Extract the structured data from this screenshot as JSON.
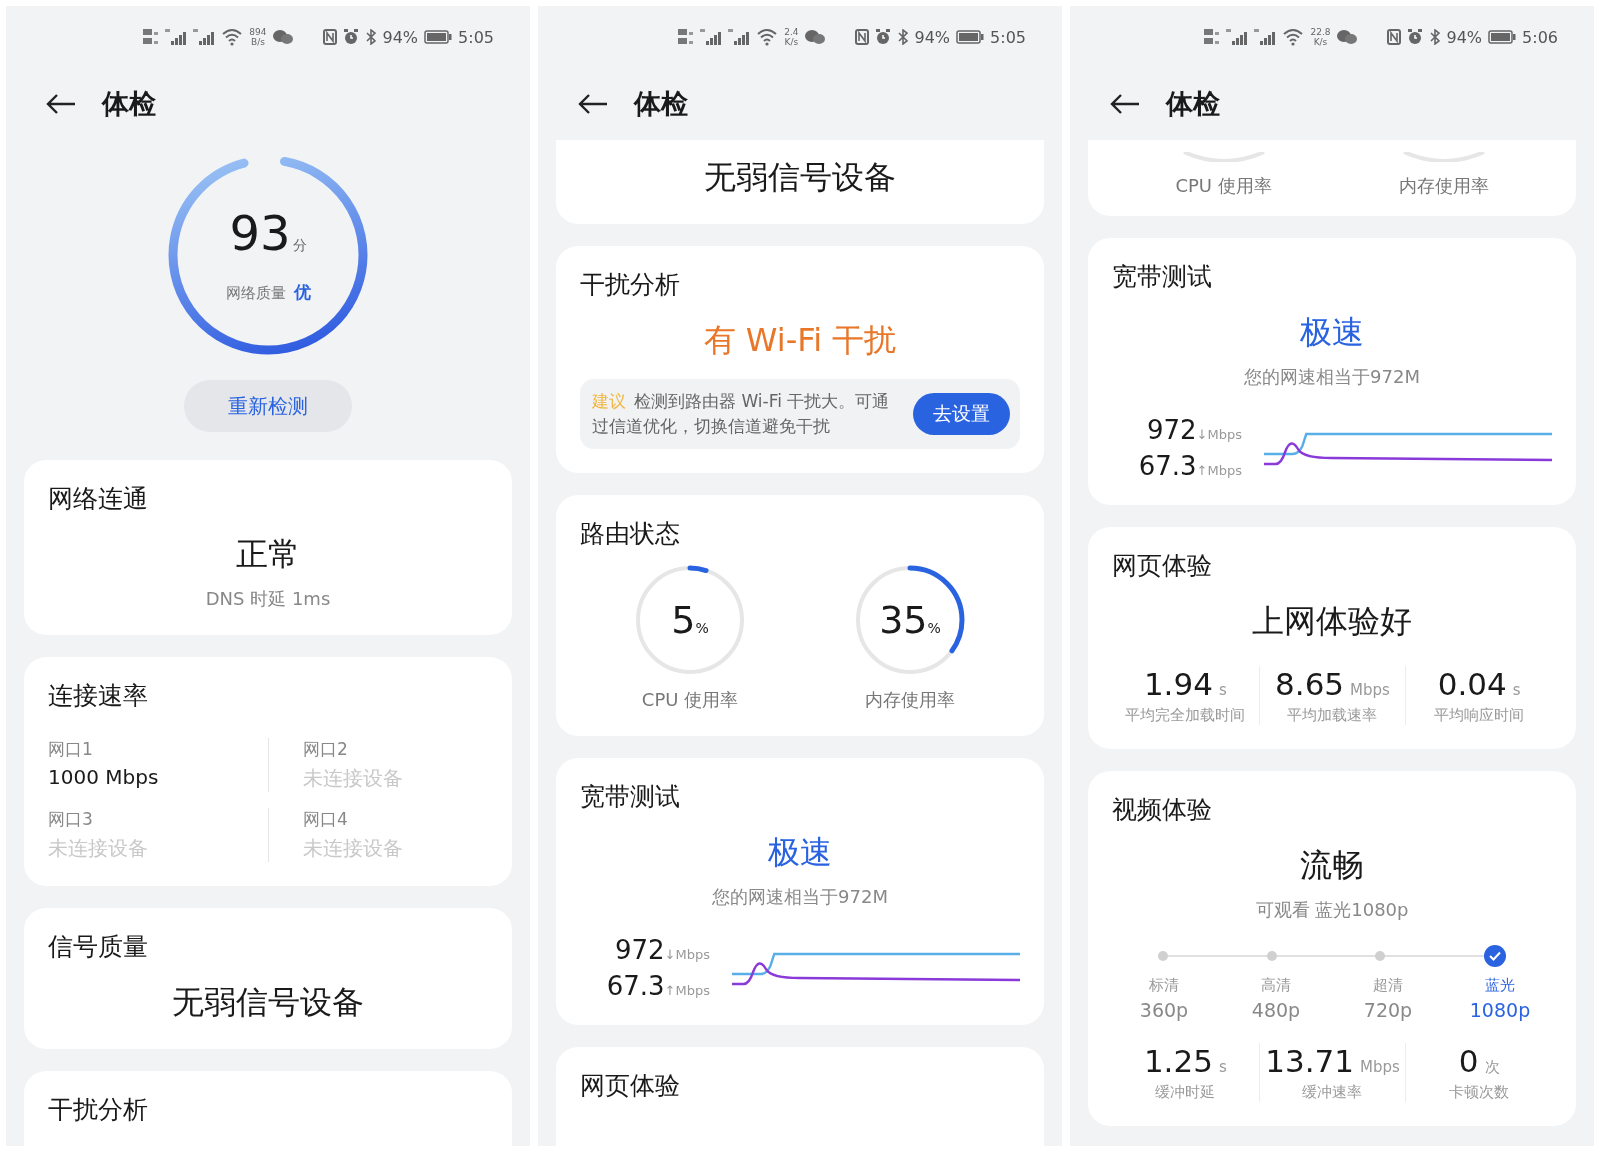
{
  "screens": [
    {
      "status_bar": {
        "speed": "894",
        "speed_unit": "B/s",
        "battery": "94%",
        "time": "5:05"
      },
      "title": "体检",
      "sections": [
        {
          "kind": "score",
          "score": "93",
          "unit": "分",
          "label": "网络质量",
          "grade": "优",
          "level": 0.93,
          "button": "重新检测"
        },
        {
          "kind": "result",
          "title": "网络连通",
          "result": "正常",
          "note": "DNS 时延 1ms",
          "color": "#1a1a1a"
        },
        {
          "kind": "ports",
          "title": "连接速率",
          "ports": [
            {
              "name": "网口1",
              "value": "1000 Mbps",
              "connected": true
            },
            {
              "name": "网口2",
              "value": "未连接设备",
              "connected": false
            },
            {
              "name": "网口3",
              "value": "未连接设备",
              "connected": false
            },
            {
              "name": "网口4",
              "value": "未连接设备",
              "connected": false
            }
          ]
        },
        {
          "kind": "result",
          "title": "信号质量",
          "result": "无弱信号设备",
          "color": "#1a1a1a"
        },
        {
          "kind": "result",
          "title": "干扰分析"
        }
      ]
    },
    {
      "status_bar": {
        "speed": "2.4",
        "speed_unit": "K/s",
        "battery": "94%",
        "time": "5:05"
      },
      "title": "体检",
      "sections": [
        {
          "kind": "result",
          "result": "无弱信号设备",
          "color": "#1a1a1a",
          "cut_top": true
        },
        {
          "kind": "interference",
          "title": "干扰分析",
          "result": "有 Wi-Fi 干扰",
          "color": "#e8772a",
          "tip_label": "建议",
          "tip": "检测到路由器 Wi-Fi 干扰大。可通过信道优化，切换信道避免干扰",
          "button": "去设置"
        },
        {
          "kind": "router",
          "title": "路由状态",
          "gauges": [
            {
              "value": "5",
              "unit": "%",
              "label": "CPU 使用率",
              "level": 0.05
            },
            {
              "value": "35",
              "unit": "%",
              "label": "内存使用率",
              "level": 0.35
            }
          ]
        },
        {
          "kind": "broadband",
          "title": "宽带测试",
          "result": "极速",
          "note": "您的网速相当于972M",
          "down": "972",
          "down_arrow": "↓",
          "down_unit": "Mbps",
          "up": "67.3",
          "up_arrow": "↑",
          "up_unit": "Mbps"
        },
        {
          "kind": "result",
          "title": "网页体验"
        }
      ]
    },
    {
      "status_bar": {
        "speed": "22.8",
        "speed_unit": "K/s",
        "battery": "94%",
        "time": "5:06"
      },
      "title": "体检",
      "sections": [
        {
          "kind": "gauge_tails",
          "labels": [
            "CPU 使用率",
            "内存使用率"
          ]
        },
        {
          "kind": "broadband",
          "title": "宽带测试",
          "result": "极速",
          "note": "您的网速相当于972M",
          "down": "972",
          "down_arrow": "↓",
          "down_unit": "Mbps",
          "up": "67.3",
          "up_arrow": "↑",
          "up_unit": "Mbps"
        },
        {
          "kind": "web",
          "title": "网页体验",
          "result": "上网体验好",
          "metrics": [
            {
              "value": "1.94",
              "unit": "s",
              "label": "平均完全加载时间"
            },
            {
              "value": "8.65",
              "unit": "Mbps",
              "label": "平均加载速率"
            },
            {
              "value": "0.04",
              "unit": "s",
              "label": "平均响应时间"
            }
          ]
        },
        {
          "kind": "video",
          "title": "视频体验",
          "result": "流畅",
          "note": "可观看 蓝光1080p",
          "qualities": [
            {
              "name": "标清",
              "res": "360p",
              "selected": false
            },
            {
              "name": "高清",
              "res": "480p",
              "selected": false
            },
            {
              "name": "超清",
              "res": "720p",
              "selected": false
            },
            {
              "name": "蓝光",
              "res": "1080p",
              "selected": true
            }
          ],
          "metrics": [
            {
              "value": "1.25",
              "unit": "s",
              "label": "缓冲时延"
            },
            {
              "value": "13.71",
              "unit": "Mbps",
              "label": "缓冲速率"
            },
            {
              "value": "0",
              "unit": "次",
              "label": "卡顿次数"
            }
          ]
        }
      ]
    }
  ]
}
